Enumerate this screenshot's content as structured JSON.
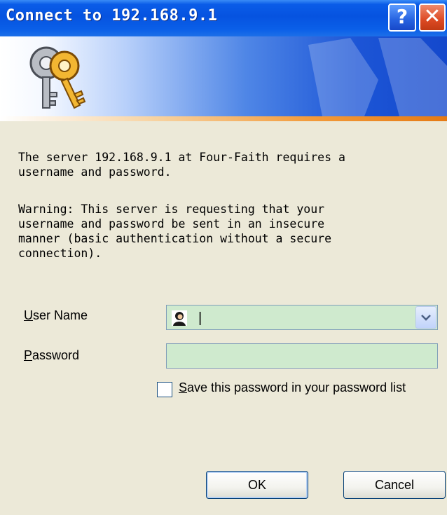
{
  "window": {
    "title": "Connect to 192.168.9.1",
    "help_glyph": "?",
    "close_glyph": "✕"
  },
  "banner": {
    "icon": "keys-icon"
  },
  "message": {
    "line1": "The server 192.168.9.1 at Four-Faith requires a\nusername and password.",
    "warning": "Warning: This server is requesting that your\nusername and password be sent in an insecure\nmanner (basic authentication without a secure\nconnection)."
  },
  "form": {
    "username_label_accel": "U",
    "username_label_rest": "ser Name",
    "username_value": "|",
    "password_label_accel": "P",
    "password_label_rest": "assword",
    "password_value": "",
    "save_label_accel": "S",
    "save_label_rest": "ave this password in your password list",
    "save_checked": false
  },
  "buttons": {
    "ok": "OK",
    "cancel": "Cancel"
  },
  "colors": {
    "titlebar": "#0653e0",
    "dialog_bg": "#ece9d8",
    "field_bg": "#cfeace",
    "accent_line": "#f29a3a"
  }
}
